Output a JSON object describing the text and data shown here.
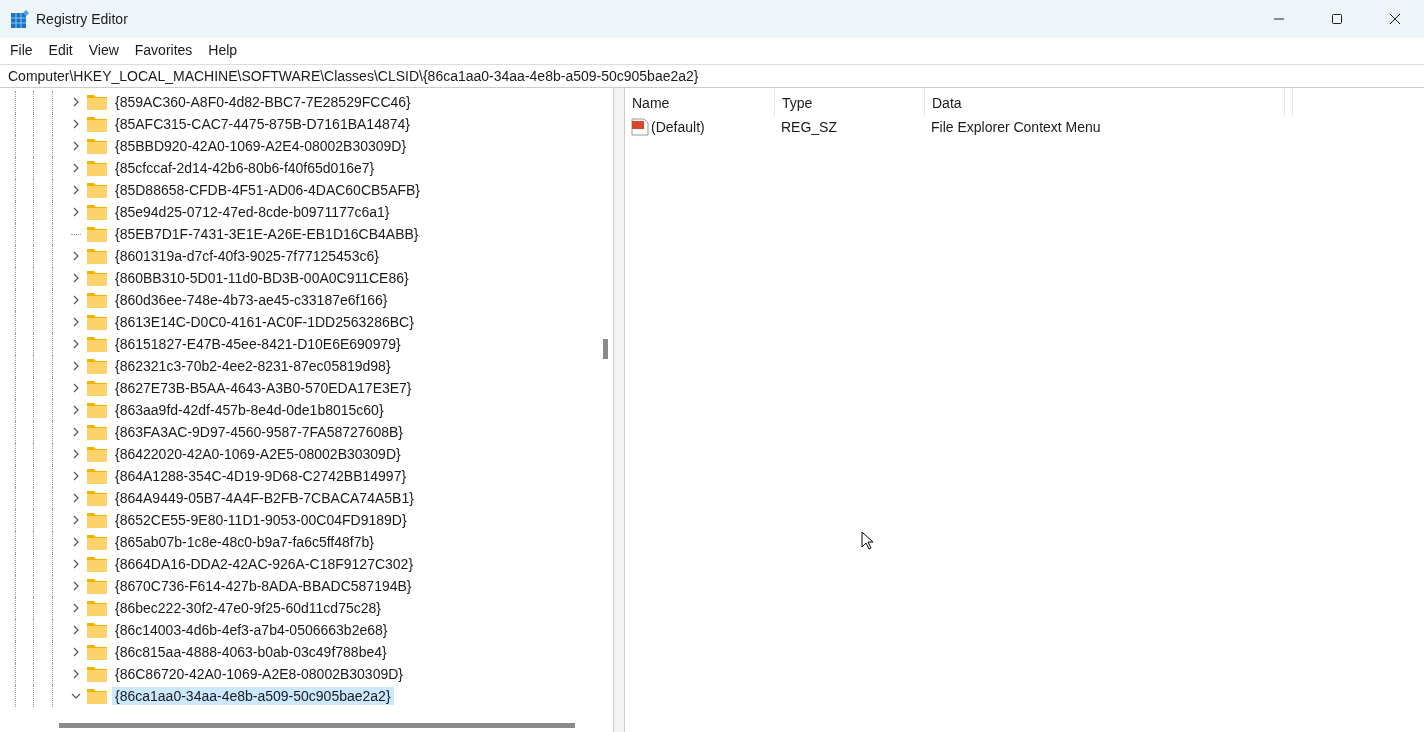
{
  "window": {
    "title": "Registry Editor"
  },
  "menu": [
    "File",
    "Edit",
    "View",
    "Favorites",
    "Help"
  ],
  "address": "Computer\\HKEY_LOCAL_MACHINE\\SOFTWARE\\Classes\\CLSID\\{86ca1aa0-34aa-4e8b-a509-50c905bae2a2}",
  "tree": [
    {
      "label": "{859AC360-A8F0-4d82-BBC7-7E28529FCC46}",
      "has_children": true,
      "expanded": false,
      "selected": false
    },
    {
      "label": "{85AFC315-CAC7-4475-875B-D7161BA14874}",
      "has_children": true,
      "expanded": false,
      "selected": false
    },
    {
      "label": "{85BBD920-42A0-1069-A2E4-08002B30309D}",
      "has_children": true,
      "expanded": false,
      "selected": false
    },
    {
      "label": "{85cfccaf-2d14-42b6-80b6-f40f65d016e7}",
      "has_children": true,
      "expanded": false,
      "selected": false
    },
    {
      "label": "{85D88658-CFDB-4F51-AD06-4DAC60CB5AFB}",
      "has_children": true,
      "expanded": false,
      "selected": false
    },
    {
      "label": "{85e94d25-0712-47ed-8cde-b0971177c6a1}",
      "has_children": true,
      "expanded": false,
      "selected": false
    },
    {
      "label": "{85EB7D1F-7431-3E1E-A26E-EB1D16CB4ABB}",
      "has_children": false,
      "selected": false
    },
    {
      "label": "{8601319a-d7cf-40f3-9025-7f77125453c6}",
      "has_children": true,
      "expanded": false,
      "selected": false
    },
    {
      "label": "{860BB310-5D01-11d0-BD3B-00A0C911CE86}",
      "has_children": true,
      "expanded": false,
      "selected": false
    },
    {
      "label": "{860d36ee-748e-4b73-ae45-c33187e6f166}",
      "has_children": true,
      "expanded": false,
      "selected": false
    },
    {
      "label": "{8613E14C-D0C0-4161-AC0F-1DD2563286BC}",
      "has_children": true,
      "expanded": false,
      "selected": false
    },
    {
      "label": "{86151827-E47B-45ee-8421-D10E6E690979}",
      "has_children": true,
      "expanded": false,
      "selected": false
    },
    {
      "label": "{862321c3-70b2-4ee2-8231-87ec05819d98}",
      "has_children": true,
      "expanded": false,
      "selected": false
    },
    {
      "label": "{8627E73B-B5AA-4643-A3B0-570EDA17E3E7}",
      "has_children": true,
      "expanded": false,
      "selected": false
    },
    {
      "label": "{863aa9fd-42df-457b-8e4d-0de1b8015c60}",
      "has_children": true,
      "expanded": false,
      "selected": false
    },
    {
      "label": "{863FA3AC-9D97-4560-9587-7FA58727608B}",
      "has_children": true,
      "expanded": false,
      "selected": false
    },
    {
      "label": "{86422020-42A0-1069-A2E5-08002B30309D}",
      "has_children": true,
      "expanded": false,
      "selected": false
    },
    {
      "label": "{864A1288-354C-4D19-9D68-C2742BB14997}",
      "has_children": true,
      "expanded": false,
      "selected": false
    },
    {
      "label": "{864A9449-05B7-4A4F-B2FB-7CBACA74A5B1}",
      "has_children": true,
      "expanded": false,
      "selected": false
    },
    {
      "label": "{8652CE55-9E80-11D1-9053-00C04FD9189D}",
      "has_children": true,
      "expanded": false,
      "selected": false
    },
    {
      "label": "{865ab07b-1c8e-48c0-b9a7-fa6c5ff48f7b}",
      "has_children": true,
      "expanded": false,
      "selected": false
    },
    {
      "label": "{8664DA16-DDA2-42AC-926A-C18F9127C302}",
      "has_children": true,
      "expanded": false,
      "selected": false
    },
    {
      "label": "{8670C736-F614-427b-8ADA-BBADC587194B}",
      "has_children": true,
      "expanded": false,
      "selected": false
    },
    {
      "label": "{86bec222-30f2-47e0-9f25-60d11cd75c28}",
      "has_children": true,
      "expanded": false,
      "selected": false
    },
    {
      "label": "{86c14003-4d6b-4ef3-a7b4-0506663b2e68}",
      "has_children": true,
      "expanded": false,
      "selected": false
    },
    {
      "label": "{86c815aa-4888-4063-b0ab-03c49f788be4}",
      "has_children": true,
      "expanded": false,
      "selected": false
    },
    {
      "label": "{86C86720-42A0-1069-A2E8-08002B30309D}",
      "has_children": true,
      "expanded": false,
      "selected": false
    },
    {
      "label": "{86ca1aa0-34aa-4e8b-a509-50c905bae2a2}",
      "has_children": true,
      "expanded": true,
      "selected": true
    }
  ],
  "table": {
    "columns": [
      "Name",
      "Type",
      "Data"
    ],
    "rows": [
      {
        "name": "(Default)",
        "type": "REG_SZ",
        "data": "File Explorer Context Menu"
      }
    ]
  }
}
